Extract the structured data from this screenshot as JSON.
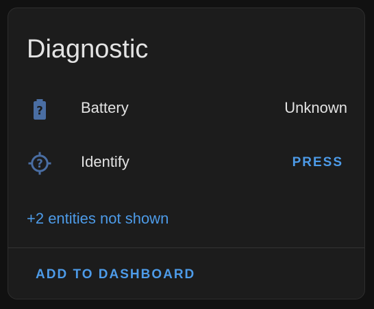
{
  "card": {
    "title": "Diagnostic",
    "rows": [
      {
        "icon": "battery-unknown-icon",
        "label": "Battery",
        "state": "Unknown"
      },
      {
        "icon": "crosshairs-question-icon",
        "label": "Identify",
        "button_label": "PRESS"
      }
    ],
    "hidden_entities_link": "+2 entities not shown",
    "action_label": "ADD TO DASHBOARD"
  },
  "colors": {
    "background": "#111111",
    "card_background": "#1c1c1c",
    "text": "#e3e3e3",
    "accent": "#4d9be8",
    "icon": "#4a6ea3"
  }
}
